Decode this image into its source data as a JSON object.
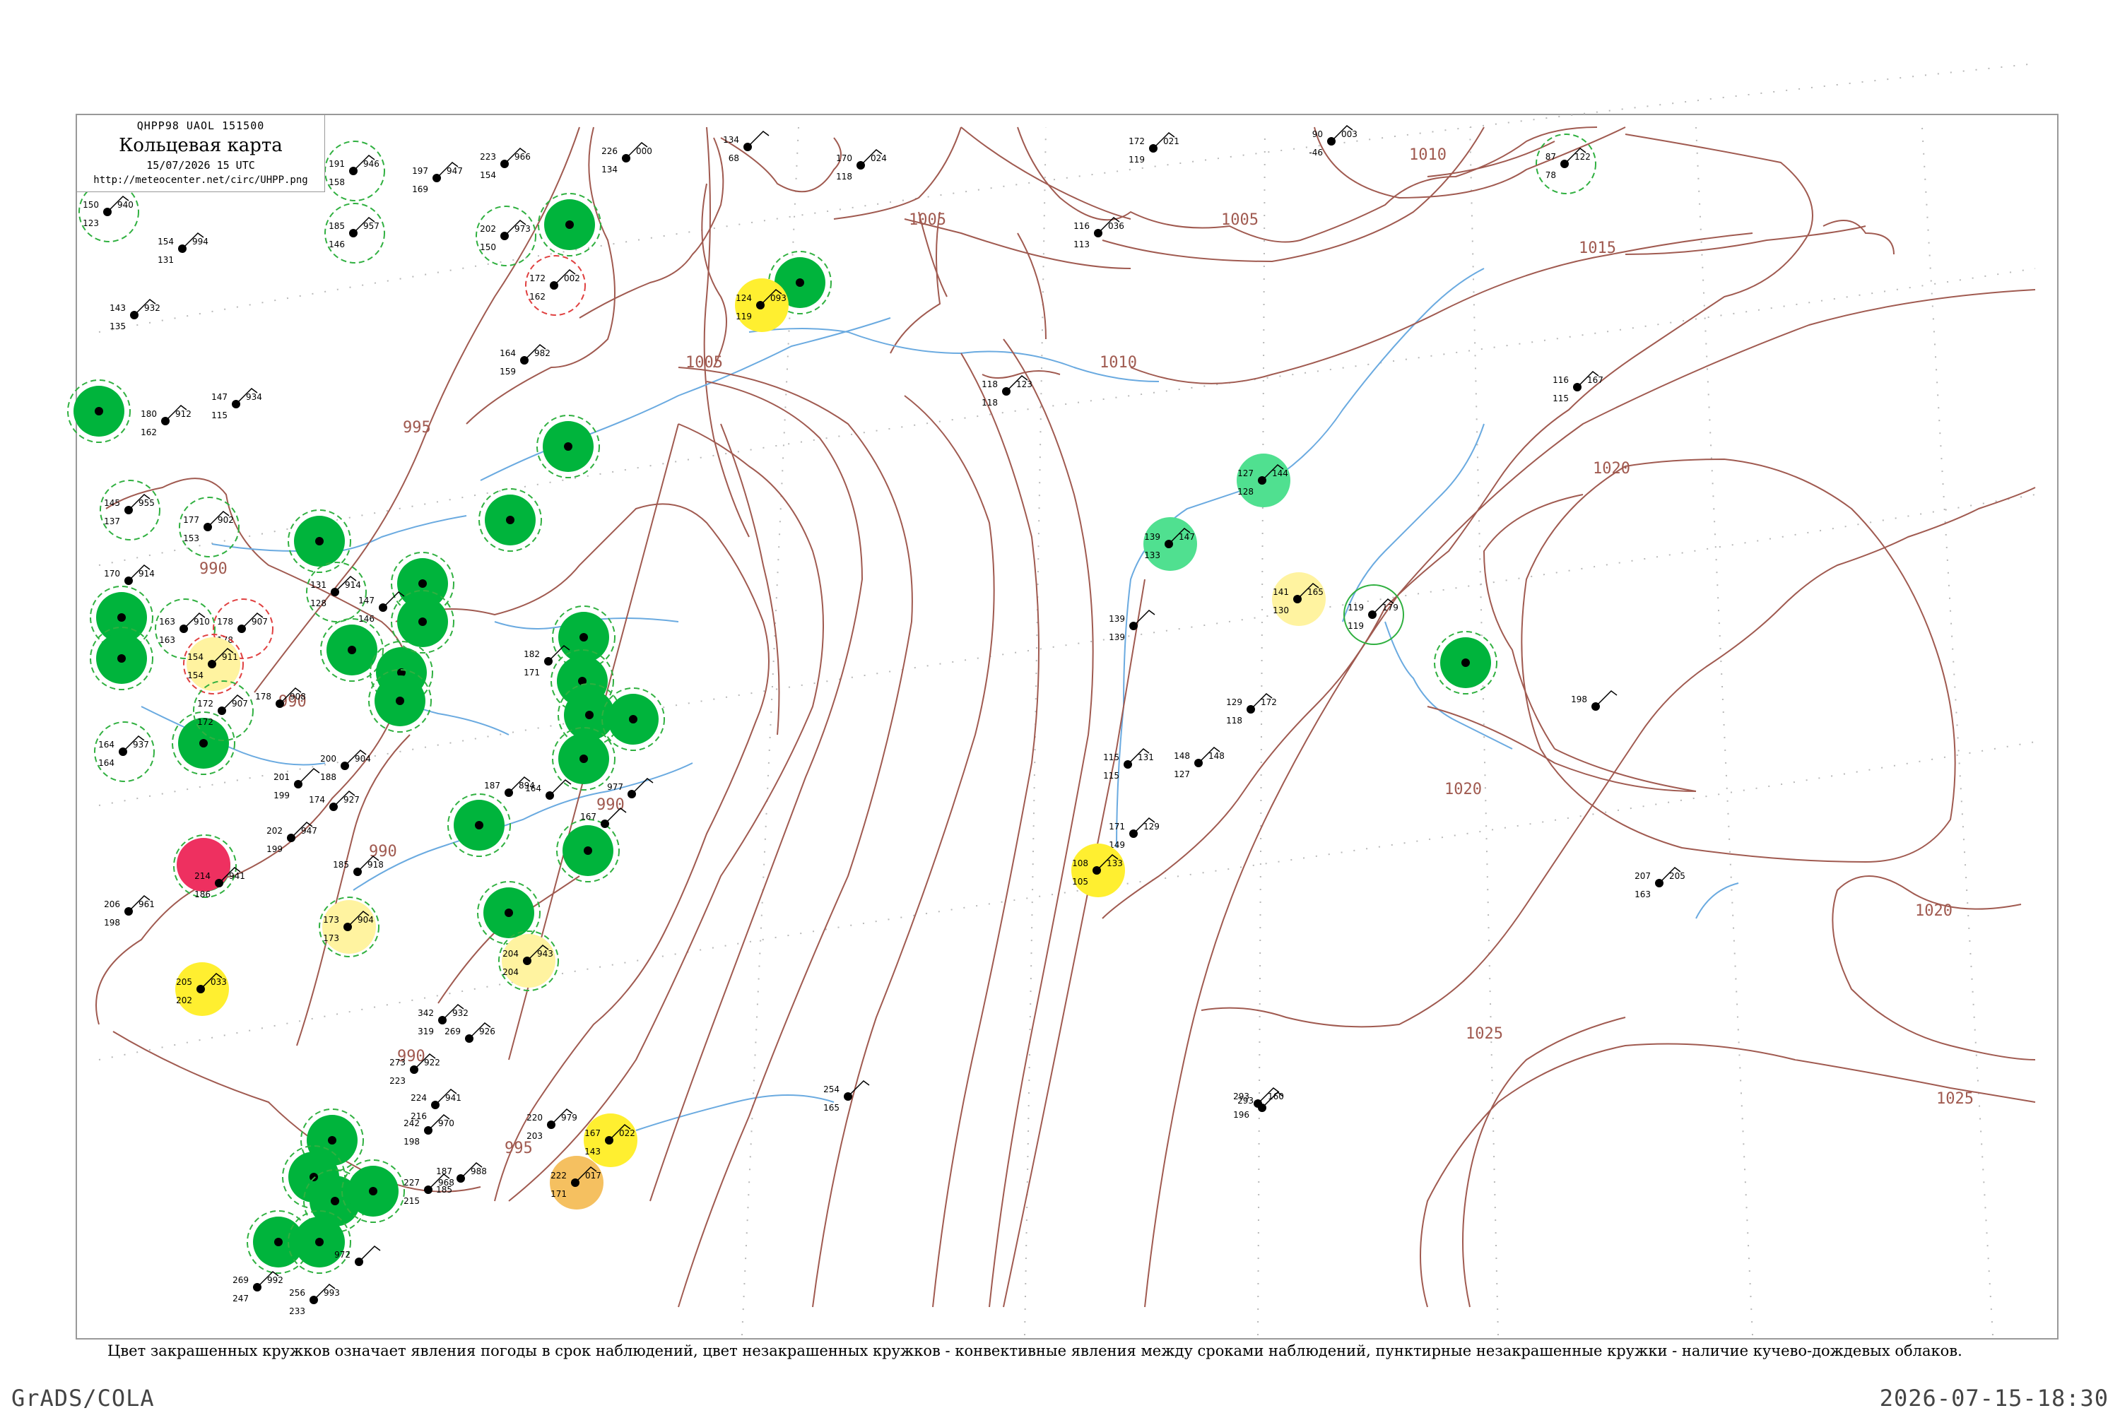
{
  "header": {
    "code": "QHPP98  UAOL  151500",
    "title": "Кольцевая карта",
    "datetime": "15/07/2026 15 UTC",
    "url": "http://meteocenter.net/circ/UHPP.png"
  },
  "isobars": [
    {
      "label": "995"
    },
    {
      "label": "990"
    },
    {
      "label": "1005"
    },
    {
      "label": "1005"
    },
    {
      "label": "1005"
    },
    {
      "label": "1010"
    },
    {
      "label": "1010"
    },
    {
      "label": "1015"
    },
    {
      "label": "1020"
    },
    {
      "label": "1020"
    },
    {
      "label": "1020"
    },
    {
      "label": "1025"
    },
    {
      "label": "1025"
    },
    {
      "label": "995"
    },
    {
      "label": "990"
    },
    {
      "label": "990"
    },
    {
      "label": "990"
    },
    {
      "label": "990"
    }
  ],
  "colors": {
    "coast": "#a05a50",
    "isobar": "#a05a50",
    "river": "#6aaae0",
    "grid": "#b0b0b0",
    "green": "#00b43c",
    "light_green": "#50e090",
    "yellow": "#ffef30",
    "pale_yellow": "#fff3a0",
    "orange": "#f5c060",
    "red": "#ee3060",
    "dashed_ring": "#30b040"
  },
  "stations": [
    {
      "t": "150",
      "p": "940",
      "td": "123"
    },
    {
      "t": "191",
      "p": "946",
      "td": "158"
    },
    {
      "t": "197",
      "p": "947",
      "td": "169"
    },
    {
      "t": "223",
      "p": "966",
      "td": "154"
    },
    {
      "t": "185",
      "p": "957",
      "td": "146"
    },
    {
      "t": "202",
      "p": "973",
      "td": "150"
    },
    {
      "t": "172",
      "p": "002",
      "td": "162"
    },
    {
      "t": "154",
      "p": "994",
      "td": "131"
    },
    {
      "t": "143",
      "p": "932",
      "td": "135"
    },
    {
      "t": "164",
      "p": "982",
      "td": "159"
    },
    {
      "t": "147",
      "p": "934",
      "td": "115"
    },
    {
      "t": "180",
      "p": "912",
      "td": "162"
    },
    {
      "t": "145",
      "p": "955",
      "td": "137"
    },
    {
      "t": "177",
      "p": "902",
      "td": "153"
    },
    {
      "t": "131",
      "p": "914",
      "td": "128"
    },
    {
      "t": "163",
      "p": "910",
      "td": "163"
    },
    {
      "t": "178",
      "p": "907",
      "td": "178"
    },
    {
      "t": "154",
      "p": "911",
      "td": "154"
    },
    {
      "t": "172",
      "p": "907",
      "td": "172"
    },
    {
      "t": "164",
      "p": "937",
      "td": "164"
    },
    {
      "t": "200",
      "p": "904",
      "td": "188"
    },
    {
      "t": "202",
      "p": "947",
      "td": "199"
    },
    {
      "t": "214",
      "p": "941",
      "td": "186"
    },
    {
      "t": "206",
      "p": "961",
      "td": "198"
    },
    {
      "t": "173",
      "p": "904",
      "td": "173"
    },
    {
      "t": "205",
      "p": "033",
      "td": "202"
    },
    {
      "t": "204",
      "p": "943",
      "td": "204"
    },
    {
      "t": "226",
      "p": "000",
      "td": "134"
    },
    {
      "t": "134",
      "p": "",
      "td": "68"
    },
    {
      "t": "170",
      "p": "024",
      "td": "118"
    },
    {
      "t": "172",
      "p": "021",
      "td": "119"
    },
    {
      "t": "90",
      "p": "003",
      "td": "-46"
    },
    {
      "t": "116",
      "p": "036",
      "td": "113"
    },
    {
      "t": "124",
      "p": "093",
      "td": "119"
    },
    {
      "t": "118",
      "p": "123",
      "td": "118"
    },
    {
      "t": "87",
      "p": "122",
      "td": "78"
    },
    {
      "t": "116",
      "p": "167",
      "td": "115"
    },
    {
      "t": "127",
      "p": "144",
      "td": "128"
    },
    {
      "t": "139",
      "p": "147",
      "td": "133"
    },
    {
      "t": "141",
      "p": "165",
      "td": "130"
    },
    {
      "t": "119",
      "p": "179",
      "td": "119"
    },
    {
      "t": "139",
      "p": "",
      "td": "139"
    },
    {
      "t": "129",
      "p": "172",
      "td": "118"
    },
    {
      "t": "115",
      "p": "131",
      "td": "115"
    },
    {
      "t": "148",
      "p": "148",
      "td": "127"
    },
    {
      "t": "171",
      "p": "129",
      "td": "149"
    },
    {
      "t": "108",
      "p": "133",
      "td": "105"
    },
    {
      "t": "207",
      "p": "205",
      "td": "163"
    },
    {
      "t": "254",
      "p": "",
      "td": "165"
    },
    {
      "t": "293",
      "p": "160",
      "td": "196"
    },
    {
      "t": "167",
      "p": "022",
      "td": "143"
    },
    {
      "t": "222",
      "p": "017",
      "td": "171"
    },
    {
      "t": "220",
      "p": "979",
      "td": "203"
    },
    {
      "t": "242",
      "p": "970",
      "td": "198"
    },
    {
      "t": "227",
      "p": "968",
      "td": "215"
    },
    {
      "t": "187",
      "p": "988",
      "td": "185"
    },
    {
      "t": "269",
      "p": "992",
      "td": "247"
    },
    {
      "t": "256",
      "p": "993",
      "td": "233"
    },
    {
      "t": "972",
      "p": "",
      "td": ""
    },
    {
      "t": "342",
      "p": "932",
      "td": "319"
    },
    {
      "t": "273",
      "p": "922",
      "td": "223"
    },
    {
      "t": "269",
      "p": "926",
      "td": ""
    },
    {
      "t": "224",
      "p": "941",
      "td": "216"
    },
    {
      "t": "187",
      "p": "894",
      "td": ""
    },
    {
      "t": "182",
      "p": "",
      "td": "171"
    },
    {
      "t": "185",
      "p": "918",
      "td": ""
    },
    {
      "t": "201",
      "p": "",
      "td": "199"
    },
    {
      "t": "178",
      "p": "908",
      "td": ""
    },
    {
      "t": "170",
      "p": "914",
      "td": ""
    },
    {
      "t": "147",
      "p": "",
      "td": "146"
    },
    {
      "t": "174",
      "p": "927",
      "td": ""
    },
    {
      "t": "977",
      "p": "",
      "td": ""
    },
    {
      "t": "167",
      "p": "",
      "td": ""
    },
    {
      "t": "164",
      "p": "",
      "td": ""
    },
    {
      "t": "198",
      "p": "",
      "td": ""
    },
    {
      "t": "293",
      "p": "",
      "td": ""
    }
  ],
  "caption": "Цвет закрашенных кружков означает явления погоды в срок наблюдений, цвет незакрашенных кружков - конвективные явления между сроками наблюдений, пунктирные незакрашенные кружки - наличие кучево-дождевых облаков.",
  "footer": {
    "left": "GrADS/COLA",
    "right": "2026-07-15-18:30"
  }
}
